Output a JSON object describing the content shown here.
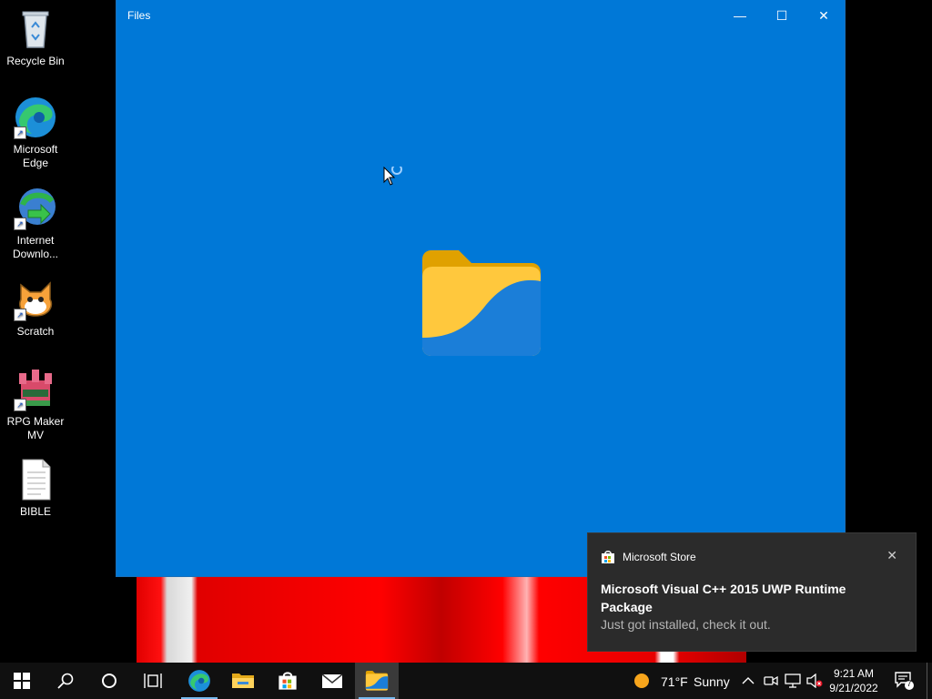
{
  "desktop_icons": [
    {
      "label": "Recycle Bin",
      "icon": "recycle-bin-icon"
    },
    {
      "label": "Microsoft Edge",
      "icon": "edge-icon"
    },
    {
      "label": "Internet Downlo...",
      "icon": "internet-download-manager-icon"
    },
    {
      "label": "Scratch",
      "icon": "scratch-icon"
    },
    {
      "label": "RPG Maker MV",
      "icon": "rpg-maker-icon"
    },
    {
      "label": "BIBLE",
      "icon": "text-document-icon"
    }
  ],
  "window": {
    "title": "Files",
    "minimize": "—",
    "maximize": "☐",
    "close": "✕",
    "background": "#0078d7"
  },
  "toast": {
    "app_name": "Microsoft Store",
    "title": "Microsoft Visual C++ 2015 UWP Runtime Package",
    "body": "Just got installed, check it out.",
    "close": "✕"
  },
  "taskbar": {
    "weather_temp": "71°F",
    "weather_desc": "Sunny",
    "time": "9:21 AM",
    "date": "9/21/2022",
    "notification_count": "7",
    "apps": [
      "start",
      "search",
      "cortana",
      "task-view",
      "edge",
      "file-explorer",
      "microsoft-store",
      "mail",
      "files"
    ]
  }
}
